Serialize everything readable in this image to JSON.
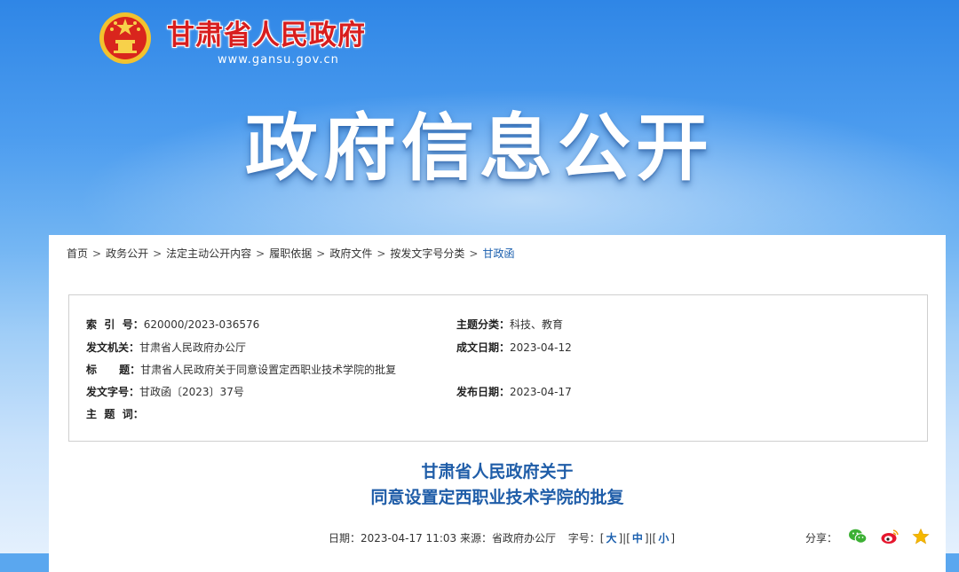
{
  "header": {
    "site_name": "甘肃省人民政府",
    "site_url": "www.gansu.gov.cn",
    "banner_title": "政府信息公开",
    "emblem_icon": "national-emblem-icon"
  },
  "breadcrumb": [
    "首页",
    "政务公开",
    "法定主动公开内容",
    "履职依据",
    "政府文件",
    "按发文字号分类",
    "甘政函"
  ],
  "meta": {
    "index_label": "索  引  号：",
    "index_value": "620000/2023-036576",
    "category_label": "主题分类：",
    "category_value": "科技、教育",
    "issuer_label": "发文机关：",
    "issuer_value": "甘肃省人民政府办公厅",
    "written_date_label": "成文日期：",
    "written_date_value": "2023-04-12",
    "title_label": "标      题：",
    "title_value": "甘肃省人民政府关于同意设置定西职业技术学院的批复",
    "doc_no_label": "发文字号：",
    "doc_no_value": "甘政函〔2023〕37号",
    "publish_date_label": "发布日期：",
    "publish_date_value": "2023-04-17",
    "keywords_label": "主  题  词：",
    "keywords_value": ""
  },
  "document": {
    "title_line1": "甘肃省人民政府关于",
    "title_line2": "同意设置定西职业技术学院的批复"
  },
  "info": {
    "date_source": "日期：2023-04-17 11:03 来源：省政府办公厅",
    "font_size_label": "字号：",
    "font_large": "大",
    "font_medium": "中",
    "font_small": "小",
    "share_label": "分享："
  },
  "colors": {
    "site_name": "#d81e1e",
    "title_blue": "#1f5da8",
    "wechat": "#3cb034",
    "weibo": "#e6162d",
    "favorite": "#f5b800"
  }
}
